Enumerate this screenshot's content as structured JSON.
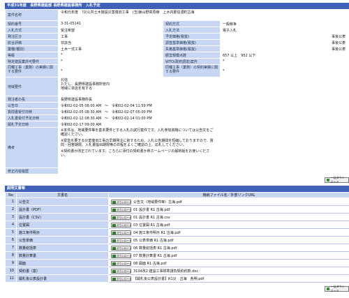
{
  "header": {
    "title": "平成31年度　長野県建設部 長野県建設事務所　入札予定"
  },
  "rows_simple": [
    {
      "label": "案件名称",
      "value": "令和元年度　?災公共土木施設災害復旧工事　(玉)飯山野高原線　上水内郡信濃町古海"
    },
    {
      "label": "契約番号",
      "value": "3-31-05141",
      "label2": "契約方式",
      "value2": "一般競争"
    },
    {
      "label": "入札方式",
      "value": "受注希望",
      "label2": "入札方法",
      "value2": "電子入札"
    },
    {
      "label": "発注区分",
      "value": "工事",
      "label2": "予定価格(税抜)",
      "value2": "事後公表"
    },
    {
      "label": "総合評価",
      "value": "非該当",
      "label2": "調査基準価格(税抜)",
      "value2": "事後公表"
    },
    {
      "label": "業種(種別)",
      "value": "土木一式工事",
      "label2": "失格基準価格(税抜)",
      "value2": "事後公表"
    },
    {
      "label": "等級",
      "value": "*",
      "label2": "経営規模点数",
      "value2": "657 以上　952 以下"
    },
    {
      "label": "特定建設業許可要件",
      "value": "*",
      "label2": "WTO(政府調達)案件",
      "value2": "*"
    },
    {
      "label": "同種工事（業務）の実績に関する要件",
      "value": "*",
      "label2": "同種工事（業務）の契約実績に関する要件",
      "value2": "*"
    }
  ],
  "region": {
    "label": "地域要件",
    "lines": [
      "北信",
      "ただし、長野県建設事務所管内",
      "地域に本店を有する"
    ]
  },
  "dates": [
    {
      "label": "発注者の長",
      "value": "長野県建設事務所長"
    },
    {
      "label": "公告日",
      "value": "令和02-02-05 08:00 AM　〜　令和02-02-04 11:59 PM"
    },
    {
      "label": "質問書受付日時",
      "value": "令和02-02-05 08:30 AM　〜　令和02-02-07 05:00 PM"
    },
    {
      "label": "入札書受付予定日時",
      "value": "令和02-02-12 08:30 AM　〜　令和02-02-14 01:00 PM"
    },
    {
      "label": "開札予定日時",
      "value": "令和02-02-17 09:00 AM"
    }
  ],
  "notes": {
    "label": "備考",
    "lines": [
      "※本件は、地域要件等を基本要件とする入札の試行案件です。入札参加資格については公告文をご確認ください。",
      "",
      "※緊急を要する災害復旧工事の早期発注に資するため、入札公告期間を短縮しておりますので、質問・回答期限、入札書提出期限等の日程をよくご確認の上、応札してください。",
      "",
      "※契約書が改正されています。こちらに添付の契約書か県ホームページの最新版をお使いください。"
    ]
  },
  "revision": {
    "label": "修正内容履歴",
    "value": ""
  },
  "download_all_label": "一括ダウンロード",
  "docs": {
    "section_title": "説明文書等",
    "headers": {
      "no": "No",
      "name": "文書名",
      "file": "格納ファイル名／外部リンクURL"
    },
    "button_label": "ダウンロード",
    "items": [
      {
        "no": "1",
        "name": "公告文",
        "file": "公告文（地域要件等）古海.pdf"
      },
      {
        "no": "2",
        "name": "設計書（PDF）",
        "file": "01 設計書 R1 古海.pdf"
      },
      {
        "no": "3",
        "name": "設計書（CSV）",
        "file": "01 設計書 R1 古海.csv"
      },
      {
        "no": "4",
        "name": "位置図",
        "file": "03 位置図 R1 古海.pdf"
      },
      {
        "no": "5",
        "name": "施工条件明示",
        "file": "04 施工条件明示 R1 古海.pdf"
      },
      {
        "no": "6",
        "name": "公告単価",
        "file": "05 公表単価 R1 古海.pdf"
      },
      {
        "no": "7",
        "name": "数量総括表",
        "file": "06 数量総括表 R1 古海.pdf"
      },
      {
        "no": "8",
        "name": "数量計算書",
        "file": "07 数量計算書 R1 古海.pdf"
      },
      {
        "no": "9",
        "name": "図面",
        "file": "08 図面 R1 古海.pdf"
      },
      {
        "no": "10",
        "name": "契約書（案）",
        "file": "3104改2 建設工事標準請負契約約款.doc"
      },
      {
        "no": "11",
        "name": "開札後公表設計書",
        "file": "【開札後公表設計書】R1災　古海　各明.pdf"
      }
    ]
  }
}
